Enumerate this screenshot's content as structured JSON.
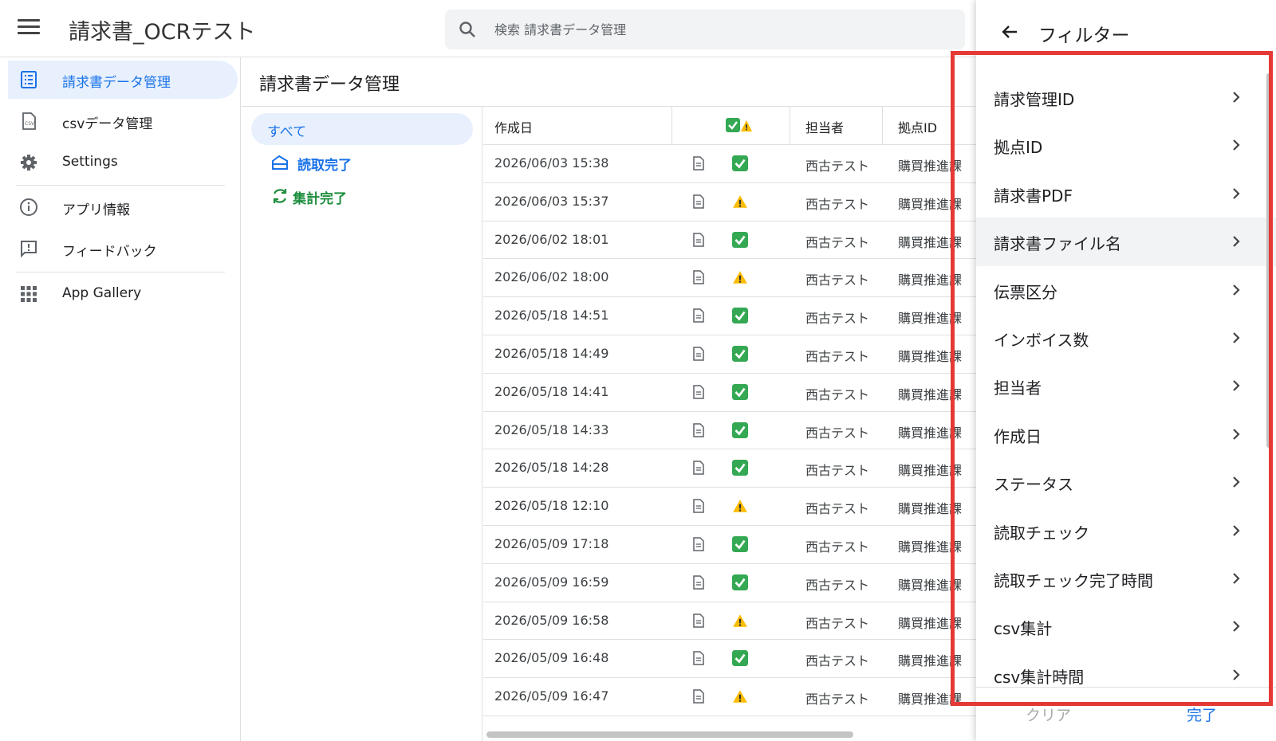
{
  "app_title": "請求書_OCRテスト",
  "search": {
    "placeholder": "検索 請求書データ管理"
  },
  "sidebar": {
    "items": [
      {
        "label": "請求書データ管理",
        "icon": "invoice-list-icon",
        "active": true
      },
      {
        "label": "csvデータ管理",
        "icon": "csv-file-icon"
      },
      {
        "label": "Settings",
        "icon": "gear-icon"
      },
      {
        "label": "アプリ情報",
        "icon": "info-icon"
      },
      {
        "label": "フィードバック",
        "icon": "feedback-icon"
      },
      {
        "label": "App Gallery",
        "icon": "grid-icon"
      }
    ]
  },
  "page_title": "請求書データ管理",
  "views": [
    {
      "label": "すべて",
      "active": true
    },
    {
      "label": "読取完了",
      "icon": "scan-icon",
      "color": "#1a73e8"
    },
    {
      "label": "集計完了",
      "icon": "sync-icon",
      "color": "#1e8e3e"
    }
  ],
  "table": {
    "columns": [
      "作成日",
      "",
      "",
      "担当者",
      "拠点ID"
    ],
    "rows": [
      {
        "date": "2026/06/03 15:38",
        "status": "ok",
        "person": "西古テスト",
        "base": "購買推進課"
      },
      {
        "date": "2026/06/03 15:37",
        "status": "warn",
        "person": "西古テスト",
        "base": "購買推進課"
      },
      {
        "date": "2026/06/02 18:01",
        "status": "ok",
        "person": "西古テスト",
        "base": "購買推進課"
      },
      {
        "date": "2026/06/02 18:00",
        "status": "warn",
        "person": "西古テスト",
        "base": "購買推進課"
      },
      {
        "date": "2026/05/18 14:51",
        "status": "ok",
        "person": "西古テスト",
        "base": "購買推進課"
      },
      {
        "date": "2026/05/18 14:49",
        "status": "ok",
        "person": "西古テスト",
        "base": "購買推進課"
      },
      {
        "date": "2026/05/18 14:41",
        "status": "ok",
        "person": "西古テスト",
        "base": "購買推進課"
      },
      {
        "date": "2026/05/18 14:33",
        "status": "ok",
        "person": "西古テスト",
        "base": "購買推進課"
      },
      {
        "date": "2026/05/18 14:28",
        "status": "ok",
        "person": "西古テスト",
        "base": "購買推進課"
      },
      {
        "date": "2026/05/18 12:10",
        "status": "warn",
        "person": "西古テスト",
        "base": "購買推進課"
      },
      {
        "date": "2026/05/09 17:18",
        "status": "ok",
        "person": "西古テスト",
        "base": "購買推進課"
      },
      {
        "date": "2026/05/09 16:59",
        "status": "ok",
        "person": "西古テスト",
        "base": "購買推進課"
      },
      {
        "date": "2026/05/09 16:58",
        "status": "warn",
        "person": "西古テスト",
        "base": "購買推進課"
      },
      {
        "date": "2026/05/09 16:48",
        "status": "ok",
        "person": "西古テスト",
        "base": "購買推進課"
      },
      {
        "date": "2026/05/09 16:47",
        "status": "warn",
        "person": "西古テスト",
        "base": "購買推進課"
      }
    ]
  },
  "filter_panel": {
    "title": "フィルター",
    "items": [
      "請求管理ID",
      "拠点ID",
      "請求書PDF",
      "請求書ファイル名",
      "伝票区分",
      "インボイス数",
      "担当者",
      "作成日",
      "ステータス",
      "読取チェック",
      "読取チェック完了時間",
      "csv集計",
      "csv集計時間"
    ],
    "hover_index": 3,
    "clear_label": "クリア",
    "done_label": "完了"
  },
  "colors": {
    "accent": "#1a73e8",
    "green": "#1e8e3e",
    "highlight": "#e53935",
    "ok": "#34a853",
    "warn": "#fbbc04"
  }
}
